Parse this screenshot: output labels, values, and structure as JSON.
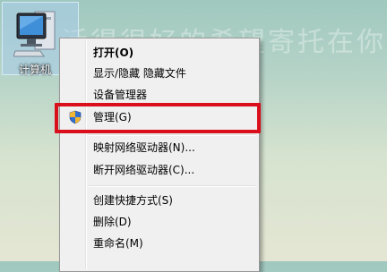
{
  "desktop": {
    "background_text": "活得很好的希望寄托在你",
    "icon_label": "计算机"
  },
  "context_menu": {
    "items": [
      {
        "label": "打开(O)",
        "bold": true
      },
      {
        "label": "显示/隐藏 隐藏文件"
      },
      {
        "label": "设备管理器"
      },
      {
        "label": "管理(G)",
        "icon": "uac-shield-icon",
        "highlighted": true
      },
      {
        "label": "映射网络驱动器(N)..."
      },
      {
        "label": "断开网络驱动器(C)..."
      },
      {
        "label": "创建快捷方式(S)"
      },
      {
        "label": "删除(D)"
      },
      {
        "label": "重命名(M)"
      }
    ]
  },
  "colors": {
    "highlight_border": "#d90f1c",
    "menu_background": "#f0f0f0"
  }
}
